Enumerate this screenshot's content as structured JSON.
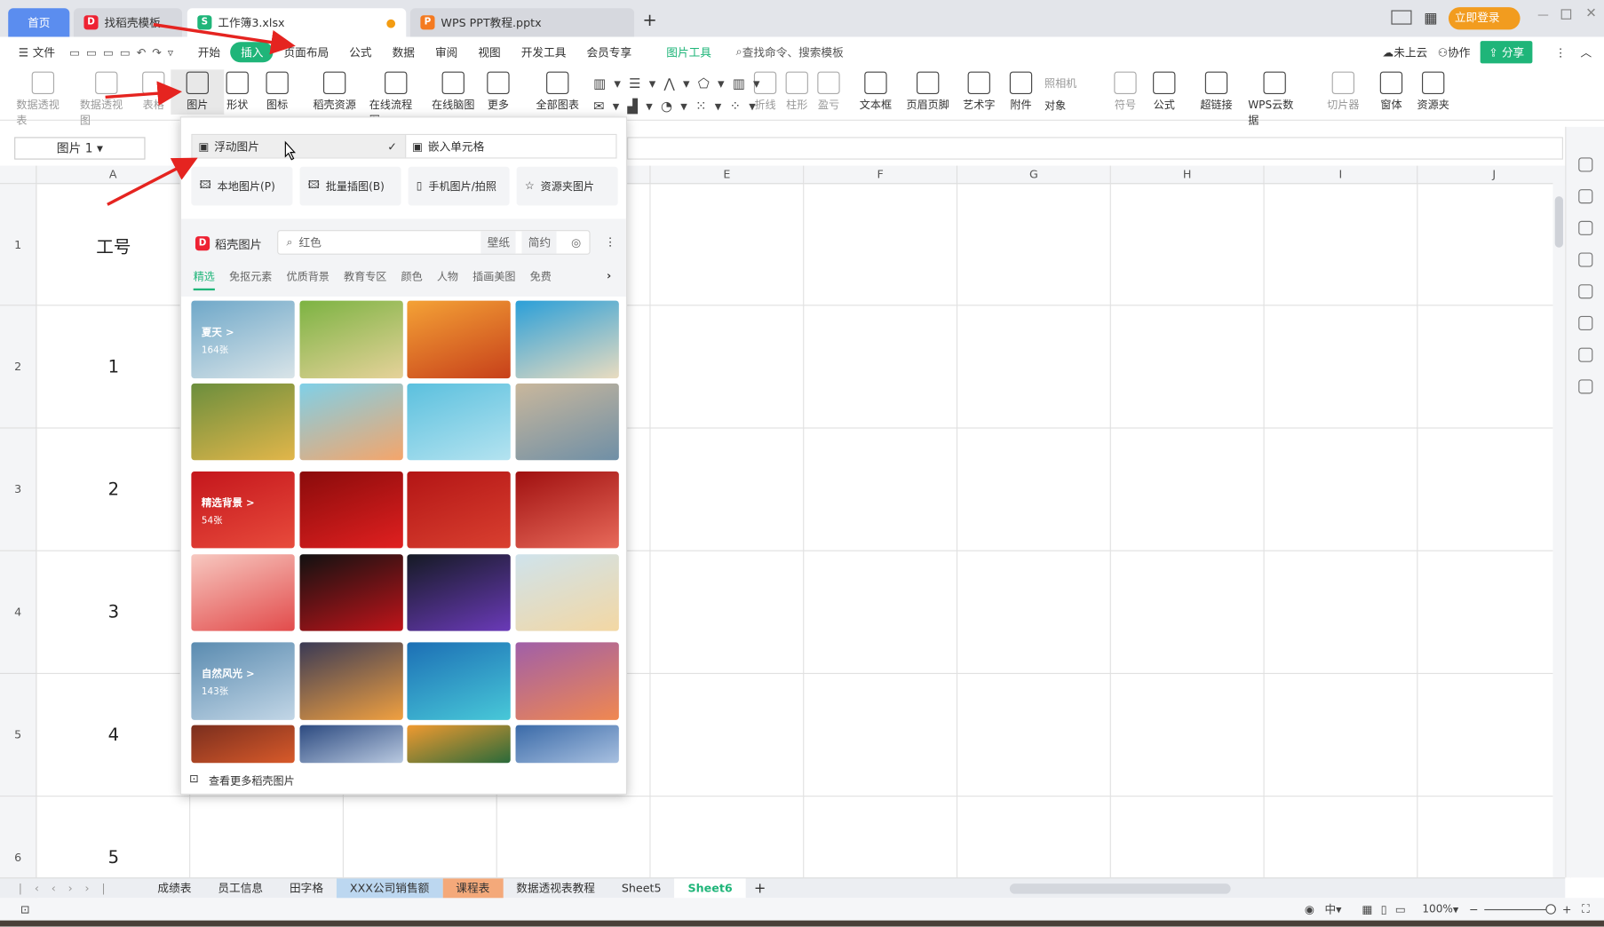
{
  "titlebar": {
    "tabs": [
      {
        "label": "首页"
      },
      {
        "label": "找稻壳模板"
      },
      {
        "label": "工作簿3.xlsx"
      },
      {
        "label": "WPS PPT教程.pptx"
      }
    ],
    "new_tab": "+",
    "login": "立即登录"
  },
  "menu": {
    "file": "文件",
    "items": [
      "开始",
      "插入",
      "页面布局",
      "公式",
      "数据",
      "审阅",
      "视图",
      "开发工具",
      "会员专享"
    ],
    "picture_tools": "图片工具",
    "search": "查找命令、搜索模板",
    "cloud": "未上云",
    "collab": "协作",
    "share": "分享"
  },
  "ribbon": {
    "items": [
      "数据透视表",
      "数据透视图",
      "表格",
      "图片",
      "形状",
      "图标",
      "稻壳资源",
      "在线流程图",
      "在线脑图",
      "更多",
      "全部图表",
      "折线",
      "柱形",
      "盈亏",
      "文本框",
      "页眉页脚",
      "艺术字",
      "附件",
      "符号",
      "公式",
      "超链接",
      "WPS云数据",
      "切片器",
      "窗体",
      "资源夹"
    ],
    "camera": "照相机",
    "object": "对象"
  },
  "namebox": "图片 1",
  "columns": [
    "A",
    "E",
    "F",
    "G",
    "H",
    "I",
    "J"
  ],
  "rows": [
    "1",
    "2",
    "3",
    "4",
    "5",
    "6"
  ],
  "cells_a": [
    "工号",
    "1",
    "2",
    "3",
    "4",
    "5"
  ],
  "panel": {
    "float": "浮动图片",
    "embed": "嵌入单元格",
    "actions": [
      "本地图片(P)",
      "批量插图(B)",
      "手机图片/拍照",
      "资源夹图片"
    ],
    "brand": "稻壳图片",
    "search": "红色",
    "chips": [
      "壁纸",
      "简约"
    ],
    "categories": [
      "精选",
      "免抠元素",
      "优质背景",
      "教育专区",
      "颜色",
      "人物",
      "插画美图",
      "免费"
    ],
    "groups": [
      {
        "title": "夏天 >",
        "count": "164张"
      },
      {
        "title": "精选背景 >",
        "count": "54张"
      },
      {
        "title": "自然风光 >",
        "count": "143张"
      }
    ],
    "more": "查看更多稻壳图片"
  },
  "sheets": [
    "成绩表",
    "员工信息",
    "田字格",
    "XXX公司销售额",
    "课程表",
    "数据透视表教程",
    "Sheet5",
    "Sheet6"
  ],
  "status": {
    "zoom": "100%"
  },
  "colors": {
    "accent": "#1fb579",
    "home_tab": "#5b8def",
    "login": "#f29c1f",
    "arrow": "#e52420"
  }
}
